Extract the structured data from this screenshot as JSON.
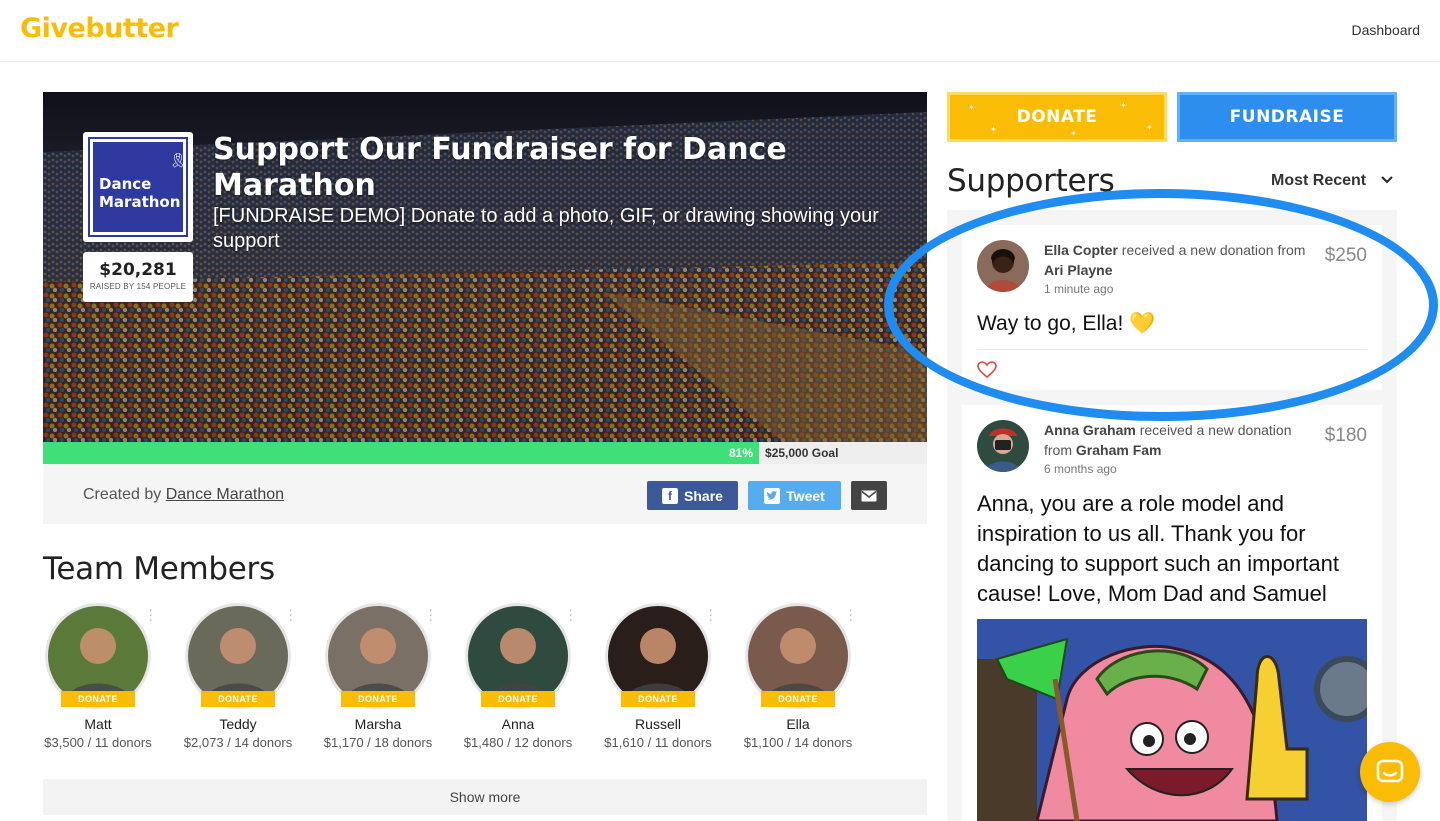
{
  "header": {
    "logo": "Givebutter",
    "nav_dashboard": "Dashboard"
  },
  "hero": {
    "team_logo_text_line1": "Dance",
    "team_logo_text_line2": "Marathon",
    "raised_amount": "$20,281",
    "raised_caption": "RAISED BY 154 PEOPLE",
    "title": "Support Our Fundraiser for Dance Marathon",
    "subtitle": "[FUNDRAISE DEMO] Donate to add a photo, GIF, or drawing showing your support"
  },
  "progress": {
    "percent": 81,
    "percent_label": "81%",
    "goal_label": "$25,000 Goal"
  },
  "creator": {
    "prefix": "Created by",
    "name": "Dance Marathon"
  },
  "share": {
    "facebook": "Share",
    "twitter": "Tweet"
  },
  "team": {
    "title": "Team Members",
    "donate_tag": "DONATE",
    "members": [
      {
        "name": "Matt",
        "stat": "$3,500 / 11 donors",
        "bg": "#5b7a3a"
      },
      {
        "name": "Teddy",
        "stat": "$2,073 / 14 donors",
        "bg": "#6a6a5a"
      },
      {
        "name": "Marsha",
        "stat": "$1,170 / 18 donors",
        "bg": "#7a7066"
      },
      {
        "name": "Anna",
        "stat": "$1,480 / 12 donors",
        "bg": "#2f4a3e"
      },
      {
        "name": "Russell",
        "stat": "$1,610 / 11 donors",
        "bg": "#2a1e1a"
      },
      {
        "name": "Ella",
        "stat": "$1,100 / 14 donors",
        "bg": "#7a5a4a"
      }
    ],
    "show_more": "Show more"
  },
  "actions": {
    "donate": "DONATE",
    "fundraise": "FUNDRAISE"
  },
  "supporters": {
    "title": "Supporters",
    "sort_label": "Most Recent",
    "items": [
      {
        "recipient": "Ella Copter",
        "action": "received a new donation",
        "from_prefix": "from",
        "donor": "Ari Playne",
        "time": "1 minute ago",
        "amount": "$250",
        "message": "Way to go, Ella! 💛"
      },
      {
        "recipient": "Anna Graham",
        "action": "received a new donation",
        "from_prefix": "from",
        "donor": "Graham Fam",
        "time": "6 months ago",
        "amount": "$180",
        "message": "Anna, you are a role model and inspiration to us all. Thank you for dancing to support such an important cause! Love, Mom Dad and Samuel"
      }
    ]
  },
  "colors": {
    "brand": "#fbbc05",
    "fundraise": "#2e8ef0",
    "progress": "#3fe078",
    "facebook": "#3b5998",
    "twitter": "#55acee",
    "annotation": "#1e8cf0"
  }
}
